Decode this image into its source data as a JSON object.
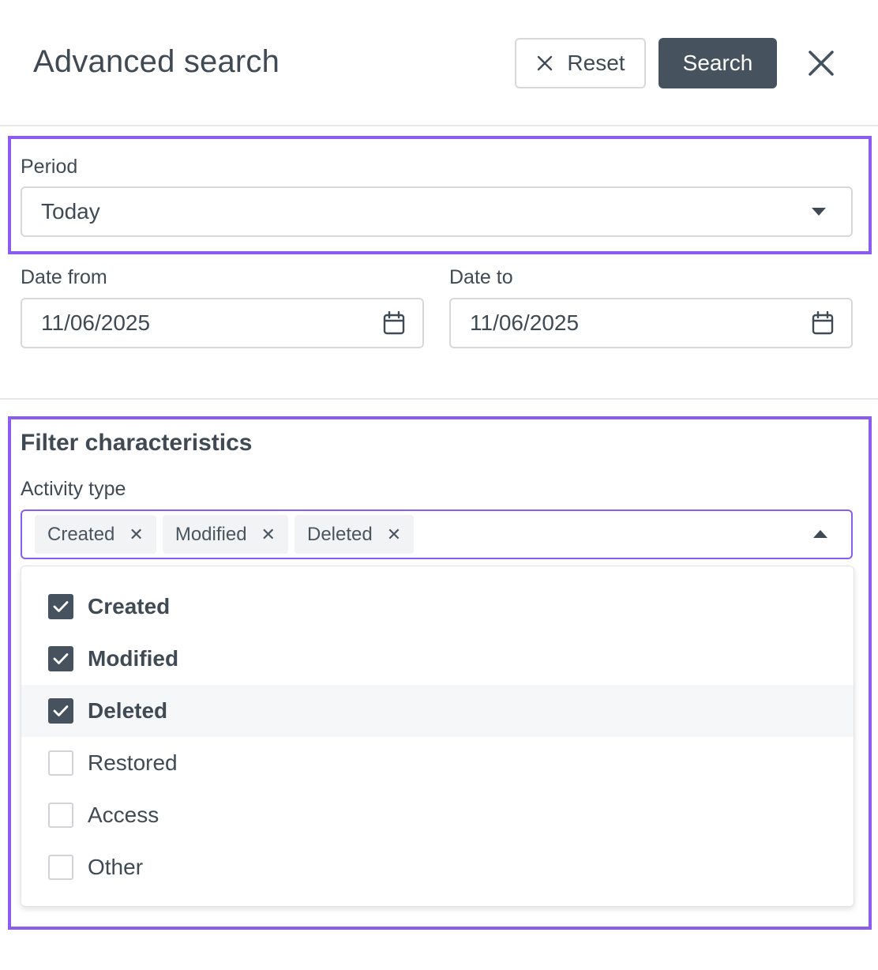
{
  "header": {
    "title": "Advanced search",
    "reset_label": "Reset",
    "search_label": "Search"
  },
  "period": {
    "label": "Period",
    "value": "Today"
  },
  "date_from": {
    "label": "Date from",
    "value": "11/06/2025"
  },
  "date_to": {
    "label": "Date to",
    "value": "11/06/2025"
  },
  "filter": {
    "title": "Filter characteristics",
    "activity_type_label": "Activity type",
    "selected_chips": [
      "Created",
      "Modified",
      "Deleted"
    ],
    "options": [
      {
        "label": "Created",
        "checked": true
      },
      {
        "label": "Modified",
        "checked": true
      },
      {
        "label": "Deleted",
        "checked": true
      },
      {
        "label": "Restored",
        "checked": false
      },
      {
        "label": "Access",
        "checked": false
      },
      {
        "label": "Other",
        "checked": false
      }
    ]
  },
  "colors": {
    "primary_button": "#46525d",
    "highlight_border": "#8a5cf0",
    "text": "#3f4a54"
  }
}
